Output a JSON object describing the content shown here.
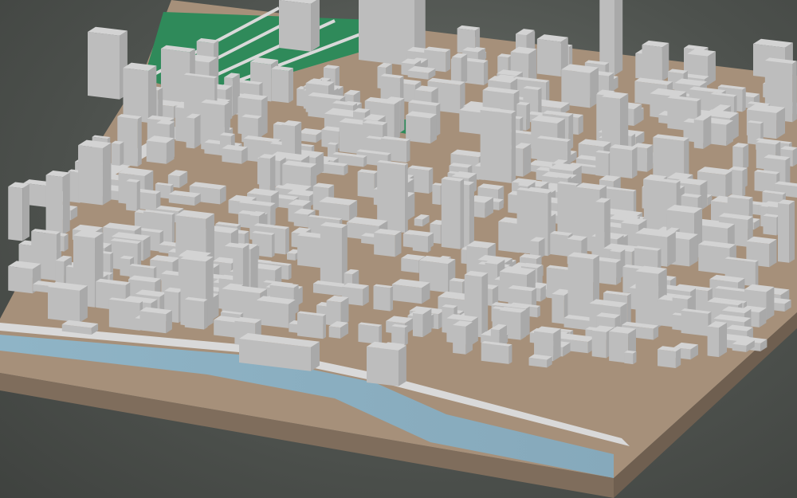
{
  "scene": {
    "subject": "3d-city-block-model",
    "colors": {
      "background": "#5a5e5a",
      "buildings": "#c9c9c9",
      "ground": "#a8917a",
      "green_space": "#2f8a5a",
      "river": "#8fb2c4",
      "base_side": "#8a7663"
    }
  }
}
